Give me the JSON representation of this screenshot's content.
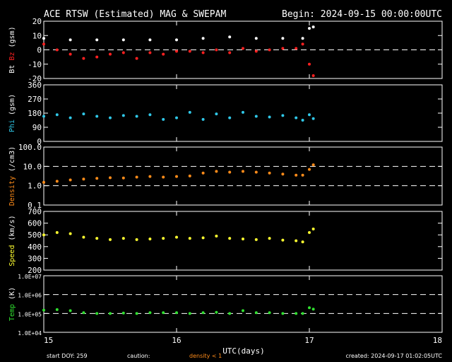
{
  "chart_data": {
    "type": "scatter",
    "title": "ACE RTSW (Estimated) MAG & SWEPAM",
    "begin": "Begin: 2024-09-15 00:00:00UTC",
    "xlabel": "UTC(days)",
    "x_ticks": [
      "15",
      "16",
      "17",
      "18"
    ],
    "xlim": [
      15,
      18
    ],
    "footer": {
      "start_doy": "start DOY: 259",
      "caution": "caution:",
      "density_note": "density < 1",
      "created": "created: 2024-09-17 01:02:05UTC"
    },
    "colors": {
      "white": "#ffffff",
      "red": "#ff2020",
      "cyan": "#30c8e8",
      "orange": "#ff8c1a",
      "yellow": "#ffff30",
      "green": "#30e030",
      "axis": "#ffffff"
    },
    "panels": [
      {
        "id": "mag",
        "ylabel_parts": [
          {
            "text": "Bt",
            "color": "#ffffff"
          },
          {
            "text": "Bz",
            "color": "#ff2020"
          },
          {
            "text": "(gsm)",
            "color": "#ffffff"
          }
        ],
        "scale": "linear",
        "ylim": [
          -20,
          20
        ],
        "ticks": [
          {
            "v": -20,
            "label": "-20"
          },
          {
            "v": -10,
            "label": "-10"
          },
          {
            "v": 0,
            "label": "0"
          },
          {
            "v": 10,
            "label": "10"
          },
          {
            "v": 20,
            "label": "20"
          }
        ],
        "dashed": [
          0
        ],
        "series": [
          {
            "color": "#ffffff",
            "x": [
              15.0,
              15.2,
              15.4,
              15.6,
              15.8,
              16.0,
              16.2,
              16.4,
              16.6,
              16.8,
              16.95,
              17.0,
              17.03
            ],
            "y": [
              8,
              7,
              7,
              7,
              7,
              7,
              8,
              9,
              8,
              8,
              8,
              15,
              16
            ]
          },
          {
            "color": "#ff2020",
            "x": [
              15.0,
              15.1,
              15.2,
              15.3,
              15.4,
              15.5,
              15.6,
              15.7,
              15.8,
              15.9,
              16.0,
              16.1,
              16.2,
              16.3,
              16.4,
              16.5,
              16.6,
              16.7,
              16.8,
              16.9,
              16.95,
              17.0,
              17.03
            ],
            "y": [
              4,
              0,
              -3,
              -6,
              -5,
              -3,
              -2,
              -6,
              -2,
              -3,
              -1,
              -1,
              -2,
              0,
              -2,
              1,
              -1,
              0,
              1,
              1,
              4,
              -10,
              -18
            ]
          }
        ]
      },
      {
        "id": "phi",
        "ylabel_parts": [
          {
            "text": "Phi",
            "color": "#30c8e8"
          },
          {
            "text": "(gsm)",
            "color": "#ffffff"
          }
        ],
        "scale": "linear",
        "ylim": [
          0,
          360
        ],
        "ticks": [
          {
            "v": 0,
            "label": "0"
          },
          {
            "v": 90,
            "label": "90"
          },
          {
            "v": 180,
            "label": "180"
          },
          {
            "v": 270,
            "label": "270"
          },
          {
            "v": 360,
            "label": "360"
          }
        ],
        "dashed": [],
        "series": [
          {
            "color": "#30c8e8",
            "x": [
              15.0,
              15.1,
              15.2,
              15.3,
              15.4,
              15.5,
              15.6,
              15.7,
              15.8,
              15.9,
              16.0,
              16.1,
              16.2,
              16.3,
              16.4,
              16.5,
              16.6,
              16.7,
              16.8,
              16.9,
              16.95,
              17.0,
              17.03
            ],
            "y": [
              160,
              170,
              150,
              175,
              160,
              150,
              165,
              160,
              170,
              140,
              150,
              185,
              140,
              175,
              150,
              185,
              160,
              155,
              165,
              150,
              135,
              170,
              145
            ]
          }
        ]
      },
      {
        "id": "density",
        "ylabel_parts": [
          {
            "text": "Density",
            "color": "#ff8c1a"
          },
          {
            "text": "(/cm3)",
            "color": "#ffffff"
          }
        ],
        "scale": "log",
        "ylim": [
          0.1,
          100
        ],
        "ticks": [
          {
            "v": 0.1,
            "label": "0.1"
          },
          {
            "v": 1,
            "label": "1.0"
          },
          {
            "v": 10,
            "label": "10.0"
          },
          {
            "v": 100,
            "label": "100.0"
          }
        ],
        "dashed": [
          1,
          10
        ],
        "series": [
          {
            "color": "#ff8c1a",
            "x": [
              15.0,
              15.1,
              15.2,
              15.3,
              15.4,
              15.5,
              15.6,
              15.7,
              15.8,
              15.9,
              16.0,
              16.1,
              16.2,
              16.3,
              16.4,
              16.5,
              16.6,
              16.7,
              16.8,
              16.9,
              16.95,
              17.0,
              17.03
            ],
            "y": [
              1.5,
              1.7,
              2,
              2.2,
              2.4,
              2.6,
              2.5,
              2.8,
              3,
              2.8,
              3,
              3.2,
              4.5,
              5.5,
              5,
              5.5,
              5,
              4.5,
              4,
              3.5,
              3.5,
              7,
              12
            ]
          }
        ]
      },
      {
        "id": "speed",
        "ylabel_parts": [
          {
            "text": "Speed",
            "color": "#ffff30"
          },
          {
            "text": "(km/s)",
            "color": "#ffffff"
          }
        ],
        "scale": "linear",
        "ylim": [
          200,
          700
        ],
        "ticks": [
          {
            "v": 200,
            "label": "200"
          },
          {
            "v": 300,
            "label": "300"
          },
          {
            "v": 400,
            "label": "400"
          },
          {
            "v": 500,
            "label": "500"
          },
          {
            "v": 600,
            "label": "600"
          },
          {
            "v": 700,
            "label": "700"
          }
        ],
        "dashed": [],
        "series": [
          {
            "color": "#ffff30",
            "x": [
              15.0,
              15.1,
              15.2,
              15.3,
              15.4,
              15.5,
              15.6,
              15.7,
              15.8,
              15.9,
              16.0,
              16.1,
              16.2,
              16.3,
              16.4,
              16.5,
              16.6,
              16.7,
              16.8,
              16.9,
              16.95,
              17.0,
              17.03
            ],
            "y": [
              500,
              520,
              510,
              480,
              470,
              460,
              470,
              460,
              465,
              470,
              480,
              470,
              475,
              490,
              470,
              465,
              460,
              470,
              455,
              450,
              440,
              520,
              550
            ]
          }
        ]
      },
      {
        "id": "temp",
        "ylabel_parts": [
          {
            "text": "Temp",
            "color": "#30e030"
          },
          {
            "text": "(K)",
            "color": "#ffffff"
          }
        ],
        "scale": "log",
        "ylim": [
          10000,
          10000000
        ],
        "ticks": [
          {
            "v": 10000,
            "label": "1.0E+04"
          },
          {
            "v": 100000,
            "label": "1.0E+05"
          },
          {
            "v": 1000000,
            "label": "1.0E+06"
          },
          {
            "v": 10000000,
            "label": "1.0E+07"
          }
        ],
        "dashed": [
          100000,
          1000000
        ],
        "series": [
          {
            "color": "#30e030",
            "x": [
              15.0,
              15.1,
              15.2,
              15.3,
              15.4,
              15.5,
              15.6,
              15.7,
              15.8,
              15.9,
              16.0,
              16.1,
              16.2,
              16.3,
              16.4,
              16.5,
              16.6,
              16.7,
              16.8,
              16.9,
              16.95,
              17.0,
              17.03
            ],
            "y": [
              150000,
              160000,
              140000,
              110000,
              100000,
              100000,
              105000,
              100000,
              110000,
              110000,
              110000,
              100000,
              110000,
              115000,
              100000,
              140000,
              110000,
              110000,
              100000,
              100000,
              100000,
              200000,
              170000
            ]
          }
        ]
      }
    ]
  }
}
